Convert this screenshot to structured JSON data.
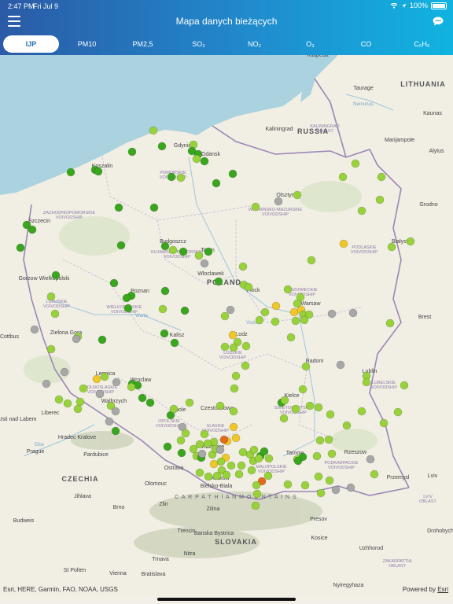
{
  "status": {
    "time": "2:47 PM",
    "date": "Fri Jul 9",
    "battery": "100%"
  },
  "header": {
    "title": "Mapa danych bieżących"
  },
  "icons": {
    "menu": "hamburger-menu-icon",
    "chat": "chat-bubble-icon",
    "wifi": "wifi-icon",
    "location": "location-arrow-icon",
    "battery": "battery-icon"
  },
  "tabs": [
    {
      "label": "IJP",
      "active": true
    },
    {
      "label": "PM10",
      "active": false
    },
    {
      "label": "PM2,5",
      "active": false
    },
    {
      "label": "SO₂",
      "active": false
    },
    {
      "label": "NO₂",
      "active": false
    },
    {
      "label": "O₃",
      "active": false
    },
    {
      "label": "CO",
      "active": false
    },
    {
      "label": "C₆H₆",
      "active": false
    }
  ],
  "colors": {
    "very_good": "#3aa61e",
    "good": "#98d23a",
    "moderate": "#d7e83a",
    "sufficient": "#f0c729",
    "bad": "#e36a1c",
    "no_data": "#a7a7a7"
  },
  "map_labels": {
    "countries": [
      "LITHUANIA",
      "RUSSIA",
      "POLAND",
      "CZECHIA",
      "SLOVAKIA"
    ],
    "regions": [
      "KALININGRAD OBLAST",
      "ZACHODNIOPOMORSKIE VOIVODSHIP",
      "POMORSKIE VOIVODSHIP",
      "WARMINSKO-MAZURSKIE VOIVODSHIP",
      "PODLASKIE VOIVODSHIP",
      "KUJAWSKO-POMORSKIE VOIVODSHIP",
      "LUBUSKIE VOIVODSHIP",
      "WIELKOPOLSKIE VOIVODSHIP",
      "MAZOWIECKIE VOIVODSHIP",
      "LODZKIE VOIVODSHIP",
      "LUBELSKIE VOIVODSHIP",
      "DOLNOSLASKIE VOIVODSHIP",
      "OPOLSKIE VOIVODSHIP",
      "SLASKIE VOIVODSHIP",
      "SWIETOKRZYSKIE VOIVODSHIP",
      "MALOPOLSKIE VOIVODSHIP",
      "PODKARPACKIE VOIVODSHIP",
      "LVIV OBLAST",
      "ZAKARPATTIA OBLAST"
    ],
    "cities": [
      "Klaipeda",
      "Taurage",
      "Kaunas",
      "Marijampole",
      "Alytus",
      "Kaliningrad",
      "Gdynia",
      "Gdansk",
      "Koszalin",
      "Olsztyn",
      "Grodno",
      "Szczecin",
      "Bialystok",
      "Bydgoszcz",
      "Torun",
      "Wloclawek",
      "Plock",
      "Gorzow Wielkopolski",
      "Poznan",
      "Warsaw",
      "Brest",
      "Cottbus",
      "Zielona Gora",
      "Kalisz",
      "Lodz",
      "Radom",
      "Lublin",
      "Legnica",
      "Wroclaw",
      "Walbrzych",
      "Usti nad Labem",
      "Liberec",
      "Opole",
      "Czestochowa",
      "Kielce",
      "Hradec Kralove",
      "Katowice",
      "Tarnow",
      "Rzeszow",
      "Prague",
      "Pardubice",
      "Ostrava",
      "Krakow",
      "Lviv",
      "Olomouc",
      "Bielsko-Biala",
      "Przemysl",
      "Jihlava",
      "Brno",
      "Zlin",
      "Zilina",
      "Presov",
      "Drohobych",
      "Trencin",
      "Banska Bystrica",
      "Kosice",
      "Uzhhorod",
      "Budweis",
      "Trnava",
      "Nitra",
      "St Polten",
      "Vienna",
      "Bratislava",
      "Nyiregyhaza"
    ],
    "mountains": "C A R P A T H I A N   M O U N T A I N S",
    "water": [
      "Nemunas",
      "Warta",
      "Elbe",
      "Vistula"
    ]
  },
  "attribution": "Esri, HERE, Garmin, FAO, NOAA, USGS",
  "powered_by": "Powered by",
  "powered_link": "Esri",
  "station_counts": {
    "very_good": 34,
    "good": 121,
    "moderate": 10,
    "sufficient": 9,
    "bad": 2,
    "no_data": 18
  }
}
